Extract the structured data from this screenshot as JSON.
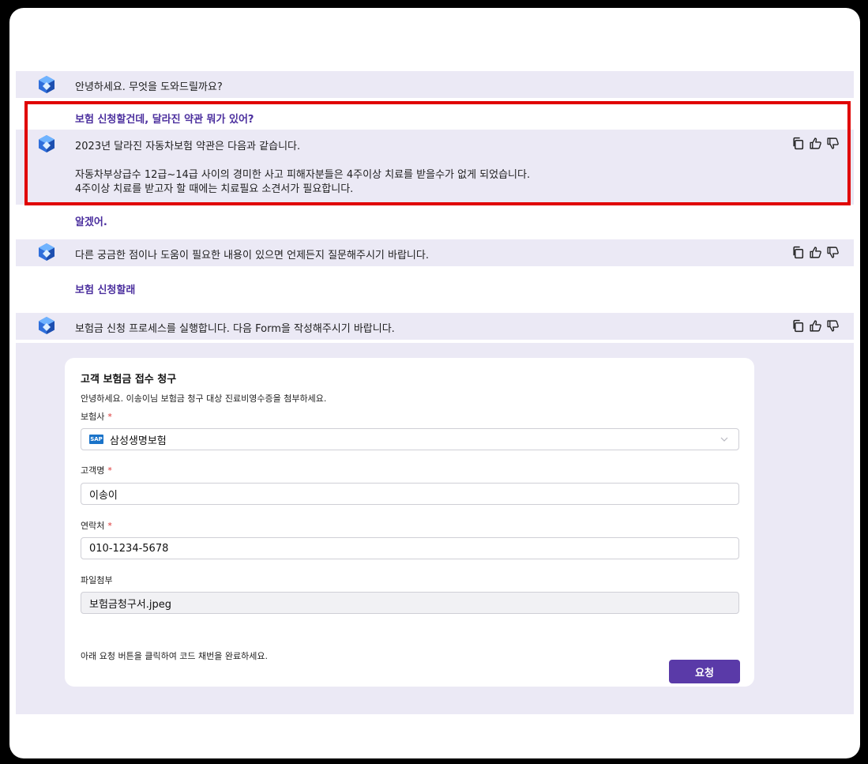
{
  "conversation": {
    "greeting": "안녕하세요. 무엇을 도와드릴까요?",
    "user_q1": "보험 신청할건데, 달라진 약관 뭐가 있어?",
    "bot_a1_line1": "2023년 달라진 자동차보험 약관은 다음과 같습니다.",
    "bot_a1_line2": "자동차부상급수 12급~14급 사이의 경미한 사고 피해자분들은 4주이상 치료를 받을수가 없게 되었습니다.",
    "bot_a1_line3": "4주이상 치료를 받고자 할 때에는 치료필요 소견서가 필요합니다.",
    "user_q2": "알겠어.",
    "bot_a2": "다른 궁금한 점이나 도움이 필요한 내용이 있으면 언제든지 질문해주시기 바랍니다.",
    "user_q3": "보험 신청할래",
    "bot_a3": "보험금 신청 프로세스를 실행합니다. 다음 Form을 작성해주시기 바랍니다."
  },
  "form": {
    "title": "고객 보험금 접수 청구",
    "description": "안녕하세요. 이송이님  보험금 청구 대상 진료비영수증을 첨부하세요.",
    "insurer_label": "보험사",
    "insurer_badge": "SAP",
    "insurer_value": "삼성생명보험",
    "name_label": "고객명",
    "name_value": "이송이",
    "contact_label": "연락처",
    "contact_value": "010-1234-5678",
    "file_label": "파일첨부",
    "file_value": "보험금청구서.jpeg",
    "required_mark": "*",
    "note": "아래 요청 버튼을 클릭하여 코드 채번을 완료하세요.",
    "submit_label": "요청"
  },
  "icons": [
    "bot-avatar-icon",
    "copy-icon",
    "thumbs-up-icon",
    "thumbs-down-icon",
    "chevron-down-icon"
  ],
  "colors": {
    "user_text": "#4b2f9e",
    "bot_band": "#ebe9f5",
    "highlight_border": "#e00000",
    "submit_button": "#5a3aa8",
    "required": "#dd3333"
  }
}
